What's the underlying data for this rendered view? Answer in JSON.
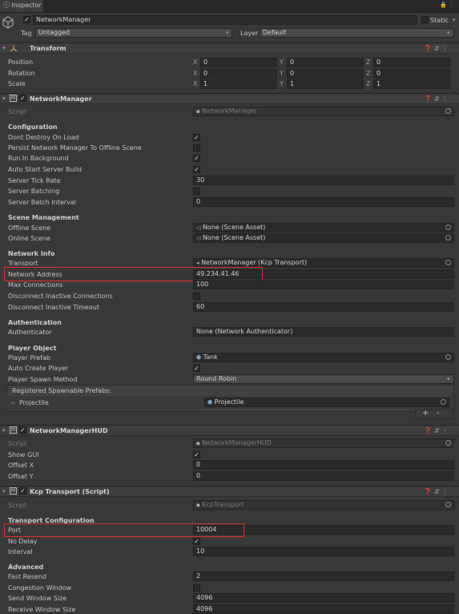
{
  "tab": {
    "title": "Inspector"
  },
  "object": {
    "name": "NetworkManager",
    "static_label": "Static",
    "tag_label": "Tag",
    "tag_value": "Untagged",
    "layer_label": "Layer",
    "layer_value": "Default"
  },
  "transform": {
    "title": "Transform",
    "rows": [
      {
        "label": "Position",
        "x": "0",
        "y": "0",
        "z": "0"
      },
      {
        "label": "Rotation",
        "x": "0",
        "y": "0",
        "z": "0"
      },
      {
        "label": "Scale",
        "x": "1",
        "y": "1",
        "z": "1"
      }
    ]
  },
  "axis": {
    "x": "X",
    "y": "Y",
    "z": "Z"
  },
  "nm": {
    "title": "NetworkManager",
    "script_label": "Script",
    "script_value": "NetworkManager",
    "configuration": "Configuration",
    "dont_destroy": "Dont Destroy On Load",
    "persist": "Persist Network Manager To Offline Scene",
    "run_bg": "Run In Background",
    "auto_start": "Auto Start Server Build",
    "tick_rate_label": "Server Tick Rate",
    "tick_rate_value": "30",
    "batching": "Server Batching",
    "batch_interval_label": "Server Batch Interval",
    "batch_interval_value": "0",
    "scene_mgmt": "Scene Management",
    "offline_label": "Offline Scene",
    "offline_value": "None (Scene Asset)",
    "online_label": "Online Scene",
    "online_value": "None (Scene Asset)",
    "network_info": "Network Info",
    "transport_label": "Transport",
    "transport_value": "NetworkManager (Kcp Transport)",
    "address_label": "Network Address",
    "address_value": "49.234.41.46",
    "max_conn_label": "Max Connections",
    "max_conn_value": "100",
    "disconnect_inactive": "Disconnect Inactive Connections",
    "timeout_label": "Disconnect Inactive Timeout",
    "timeout_value": "60",
    "authentication": "Authentication",
    "auth_label": "Authenticator",
    "auth_value": "None (Network Authenticator)",
    "player_object": "Player Object",
    "prefab_label": "Player Prefab",
    "prefab_value": "Tank",
    "auto_create": "Auto Create Player",
    "spawn_label": "Player Spawn Method",
    "spawn_value": "Round Robin",
    "registered": "Registered Spawnable Prefabs:",
    "list_item_label": "Projectile",
    "list_item_value": "Projectile",
    "plus": "+",
    "minus": "-"
  },
  "hud": {
    "title": "NetworkManagerHUD",
    "script_label": "Script",
    "script_value": "NetworkManagerHUD",
    "show_gui": "Show GUI",
    "offset_x_label": "Offset X",
    "offset_x_value": "0",
    "offset_y_label": "Offset Y",
    "offset_y_value": "0"
  },
  "kcp": {
    "title": "Kcp Transport (Script)",
    "script_label": "Script",
    "script_value": "KcpTransport",
    "transport_config": "Transport Configuration",
    "port_label": "Port",
    "port_value": "10004",
    "no_delay": "No Delay",
    "interval_label": "Interval",
    "interval_value": "10",
    "advanced": "Advanced",
    "fast_resend_label": "Fast Resend",
    "fast_resend_value": "2",
    "congestion": "Congestion Window",
    "send_window_label": "Send Window Size",
    "send_window_value": "4096",
    "recv_window_label": "Receive Window Size",
    "recv_window_value": "4096"
  },
  "check": "✓",
  "colors": {
    "highlight": "#e03030",
    "background": "#383838"
  }
}
